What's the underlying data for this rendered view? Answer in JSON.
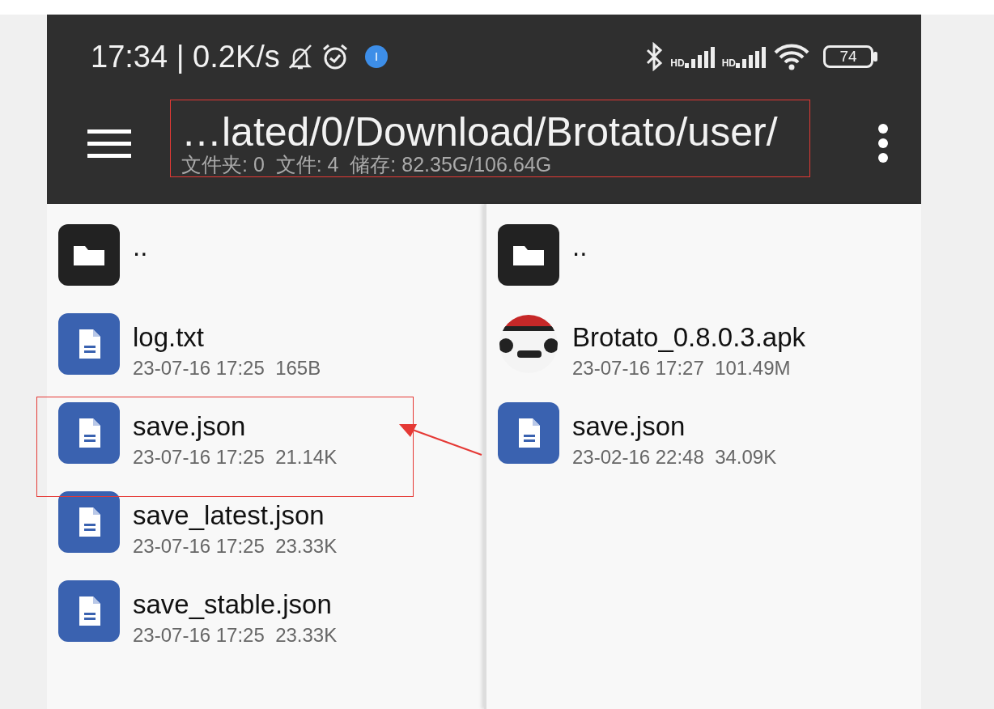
{
  "status_bar": {
    "time": "17:34 | 0.2K/s",
    "signal_labels": [
      "HD",
      "HD"
    ],
    "battery": "74"
  },
  "toolbar": {
    "title": "…lated/0/Download/Brotato/user/",
    "subtitle": "文件夹: 0  文件: 4  储存: 82.35G/106.64G",
    "highlighted": true
  },
  "panes": [
    {
      "items": [
        {
          "kind": "folder",
          "name": "..",
          "highlighted": false
        },
        {
          "kind": "document",
          "name": "log.txt",
          "meta": "23-07-16 17:25  165B",
          "highlighted": false
        },
        {
          "kind": "document",
          "name": "save.json",
          "meta": "23-07-16 17:25  21.14K",
          "highlighted": true
        },
        {
          "kind": "document",
          "name": "save_latest.json",
          "meta": "23-07-16 17:25  23.33K",
          "highlighted": false
        },
        {
          "kind": "document",
          "name": "save_stable.json",
          "meta": "23-07-16 17:25  23.33K",
          "highlighted": false
        }
      ]
    },
    {
      "items": [
        {
          "kind": "folder",
          "name": "..",
          "highlighted": false
        },
        {
          "kind": "app",
          "name": "Brotato_0.8.0.3.apk",
          "meta": "23-07-16 17:27  101.49M",
          "highlighted": false
        },
        {
          "kind": "document",
          "name": "save.json",
          "meta": "23-02-16 22:48  34.09K",
          "highlighted": false
        }
      ]
    }
  ]
}
